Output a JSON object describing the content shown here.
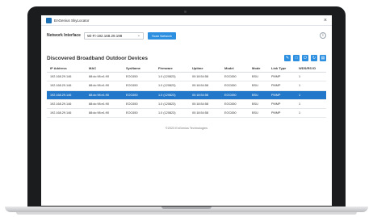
{
  "window": {
    "title": "EnGenius SkyLocator",
    "close_glyph": "×"
  },
  "toolbar": {
    "network_interface_label": "Network Interface",
    "network_interface_value": "Wi-Fi-192.168.29.198",
    "scan_button": "Scan Network",
    "info_icon": "info-icon"
  },
  "section": {
    "title": "Discovered Broadband Outdoor Devices",
    "actions": [
      {
        "icon": "wrench-icon",
        "glyph": "✎"
      },
      {
        "icon": "window-icon",
        "glyph": "□"
      },
      {
        "icon": "power-icon",
        "glyph": "⏻"
      },
      {
        "icon": "refresh-icon",
        "glyph": "↻"
      },
      {
        "icon": "file-icon",
        "glyph": "▤"
      }
    ]
  },
  "table": {
    "columns": [
      "IP Address",
      "MAC",
      "SysName",
      "Firmware",
      "Uptime",
      "Model",
      "Mode",
      "Link Type",
      "WDS/RS ID"
    ],
    "rows": [
      [
        "192.168.29.146",
        "88:dc:98:e1:90",
        "EOC650",
        "1.0 (120823)",
        "00:18:54:58",
        "EOC650",
        "BSU",
        "PMMP",
        "1"
      ],
      [
        "192.168.29.146",
        "88:dc:98:e1:90",
        "EOC650",
        "1.0 (120823)",
        "00:18:54:58",
        "EOC650",
        "BSU",
        "PMMP",
        "1"
      ],
      [
        "192.168.29.146",
        "88:dc:98:e1:90",
        "EOC650",
        "1.0 (120823)",
        "00:18:54:58",
        "EOC650",
        "BSU",
        "PMMP",
        "1"
      ],
      [
        "192.168.29.146",
        "88:dc:98:e1:90",
        "EOC650",
        "1.0 (120823)",
        "00:18:54:58",
        "EOC650",
        "BSU",
        "PMMP",
        "1"
      ],
      [
        "192.168.29.146",
        "88:dc:98:e1:90",
        "EOC650",
        "1.0 (120823)",
        "00:18:54:58",
        "EOC650",
        "BSU",
        "PMMP",
        "1"
      ]
    ],
    "selected_row": 2
  },
  "footer": {
    "copyright": "©2023 EnGenius Technologies"
  },
  "colors": {
    "accent": "#2d8fe0",
    "selection": "#2478c9",
    "laptop_bezel": "#1b1c1e"
  }
}
